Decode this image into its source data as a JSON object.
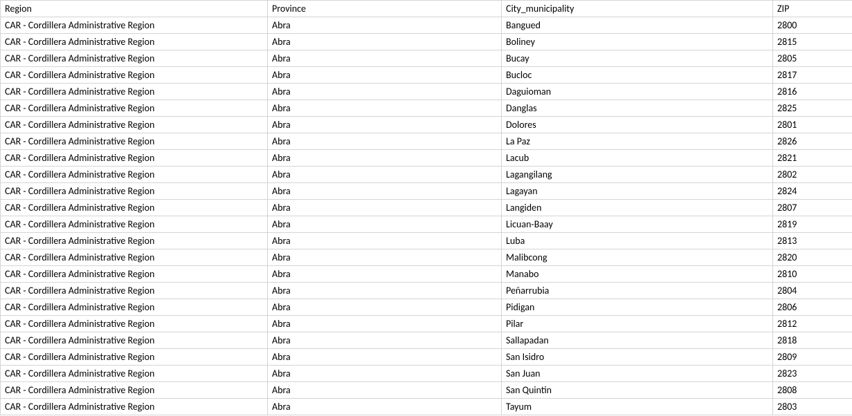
{
  "headers": {
    "region": "Region",
    "province": "Province",
    "city": "City_municipality",
    "zip": "ZIP"
  },
  "rows": [
    {
      "region": "CAR  - Cordillera Administrative Region",
      "province": "Abra",
      "city": "Bangued",
      "zip": "2800"
    },
    {
      "region": "CAR  - Cordillera Administrative Region",
      "province": "Abra",
      "city": "Boliney",
      "zip": "2815"
    },
    {
      "region": "CAR  - Cordillera Administrative Region",
      "province": "Abra",
      "city": "Bucay",
      "zip": "2805"
    },
    {
      "region": "CAR  - Cordillera Administrative Region",
      "province": "Abra",
      "city": "Bucloc",
      "zip": "2817"
    },
    {
      "region": "CAR  - Cordillera Administrative Region",
      "province": "Abra",
      "city": "Daguioman",
      "zip": "2816"
    },
    {
      "region": "CAR  - Cordillera Administrative Region",
      "province": "Abra",
      "city": "Danglas",
      "zip": "2825"
    },
    {
      "region": "CAR  - Cordillera Administrative Region",
      "province": "Abra",
      "city": "Dolores",
      "zip": "2801"
    },
    {
      "region": "CAR  - Cordillera Administrative Region",
      "province": "Abra",
      "city": "La Paz",
      "zip": "2826"
    },
    {
      "region": "CAR  - Cordillera Administrative Region",
      "province": "Abra",
      "city": "Lacub",
      "zip": "2821"
    },
    {
      "region": "CAR  - Cordillera Administrative Region",
      "province": "Abra",
      "city": "Lagangilang",
      "zip": "2802"
    },
    {
      "region": "CAR  - Cordillera Administrative Region",
      "province": "Abra",
      "city": "Lagayan",
      "zip": "2824"
    },
    {
      "region": "CAR  - Cordillera Administrative Region",
      "province": "Abra",
      "city": "Langiden",
      "zip": "2807"
    },
    {
      "region": "CAR  - Cordillera Administrative Region",
      "province": "Abra",
      "city": "Licuan-Baay",
      "zip": "2819"
    },
    {
      "region": "CAR  - Cordillera Administrative Region",
      "province": "Abra",
      "city": "Luba",
      "zip": "2813"
    },
    {
      "region": "CAR  - Cordillera Administrative Region",
      "province": "Abra",
      "city": "Malibcong",
      "zip": "2820"
    },
    {
      "region": "CAR  - Cordillera Administrative Region",
      "province": "Abra",
      "city": "Manabo",
      "zip": "2810"
    },
    {
      "region": "CAR  - Cordillera Administrative Region",
      "province": "Abra",
      "city": "Peñarrubia",
      "zip": "2804"
    },
    {
      "region": "CAR  - Cordillera Administrative Region",
      "province": "Abra",
      "city": "Pidigan",
      "zip": "2806"
    },
    {
      "region": "CAR  - Cordillera Administrative Region",
      "province": "Abra",
      "city": "Pilar",
      "zip": "2812"
    },
    {
      "region": "CAR  - Cordillera Administrative Region",
      "province": "Abra",
      "city": "Sallapadan",
      "zip": "2818"
    },
    {
      "region": "CAR  - Cordillera Administrative Region",
      "province": "Abra",
      "city": "San Isidro",
      "zip": "2809"
    },
    {
      "region": "CAR  - Cordillera Administrative Region",
      "province": "Abra",
      "city": "San Juan",
      "zip": "2823"
    },
    {
      "region": "CAR  - Cordillera Administrative Region",
      "province": "Abra",
      "city": "San Quintin",
      "zip": "2808"
    },
    {
      "region": "CAR  - Cordillera Administrative Region",
      "province": "Abra",
      "city": "Tayum",
      "zip": "2803"
    }
  ]
}
